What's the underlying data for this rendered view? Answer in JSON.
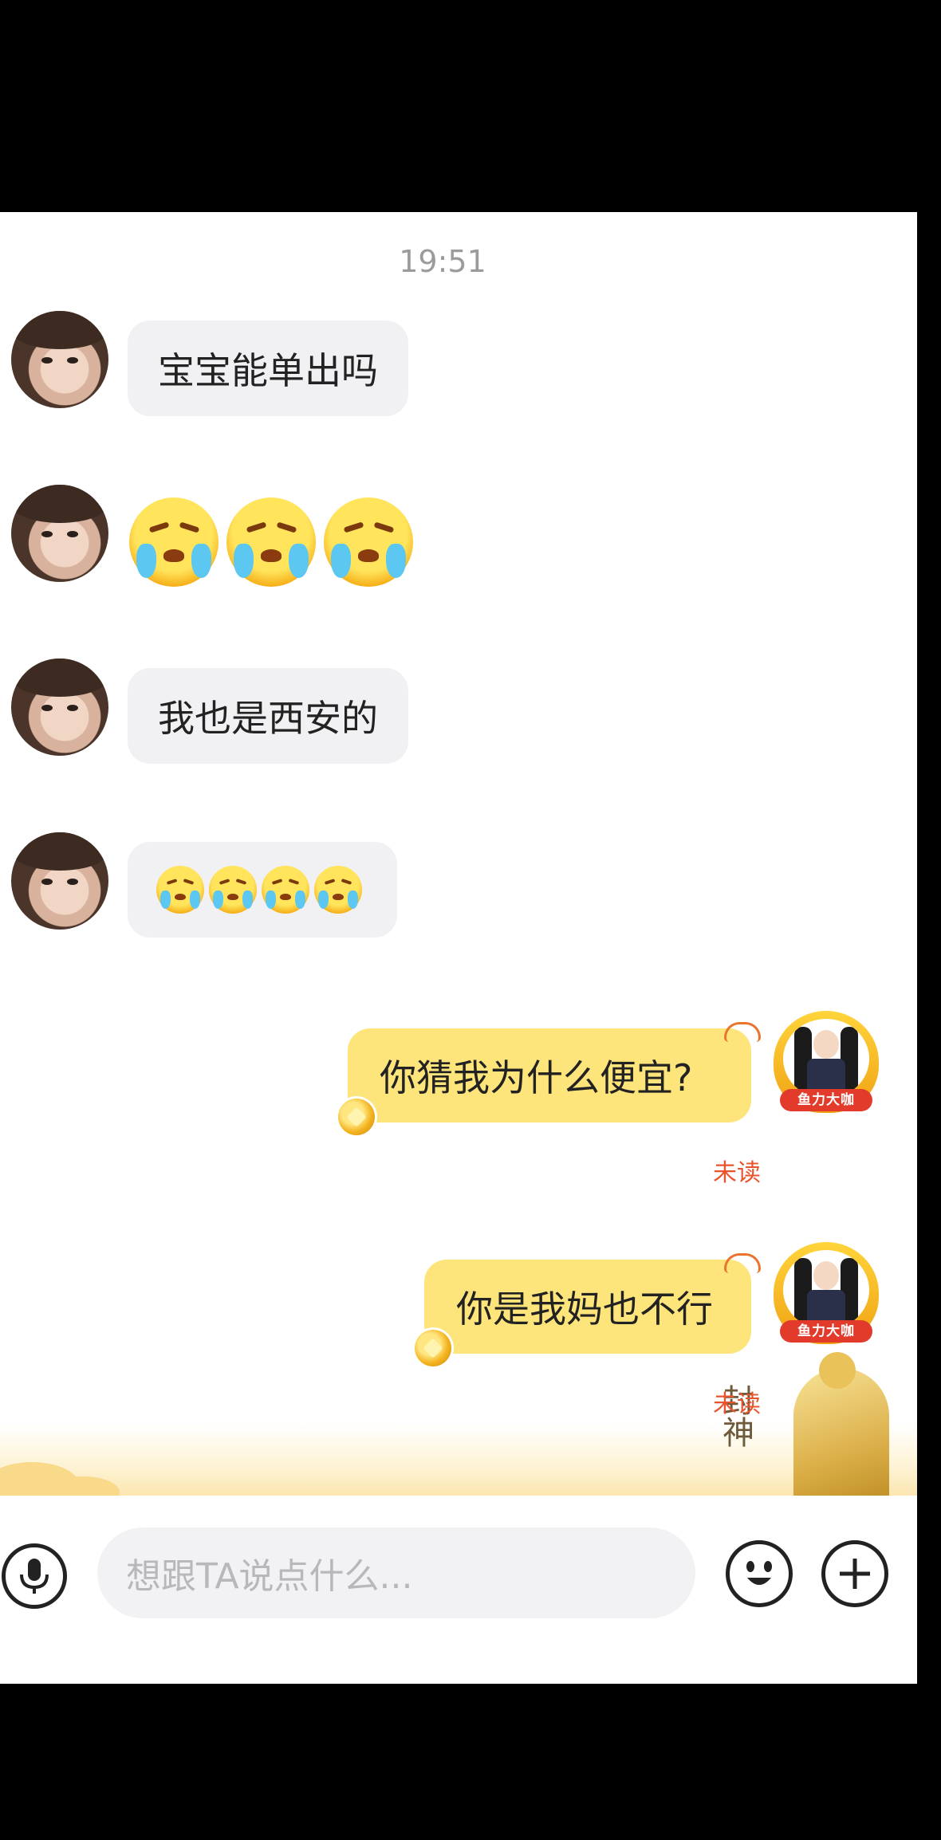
{
  "chat": {
    "timestamp": "19:51",
    "incoming": [
      {
        "type": "text",
        "text": "宝宝能单出吗"
      },
      {
        "type": "emoji",
        "emoji": "crying-face",
        "count": 3
      },
      {
        "type": "text",
        "text": "我也是西安的"
      },
      {
        "type": "emoji",
        "emoji": "crying-face",
        "count": 4
      }
    ],
    "outgoing": [
      {
        "text": "你猜我为什么便宜?",
        "status": "未读"
      },
      {
        "text": "你是我妈也不行",
        "status": "未读"
      }
    ],
    "self_avatar_badge": "鱼力大咖",
    "decoration_text": "封神"
  },
  "input": {
    "placeholder": "想跟TA说点什么..."
  },
  "icons": {
    "voice": "microphone-icon",
    "emoji": "smiley-icon",
    "more": "plus-icon"
  },
  "colors": {
    "outgoing_bubble": "#fde57c",
    "incoming_bubble": "#f1f1f3",
    "unread": "#e8542e"
  }
}
